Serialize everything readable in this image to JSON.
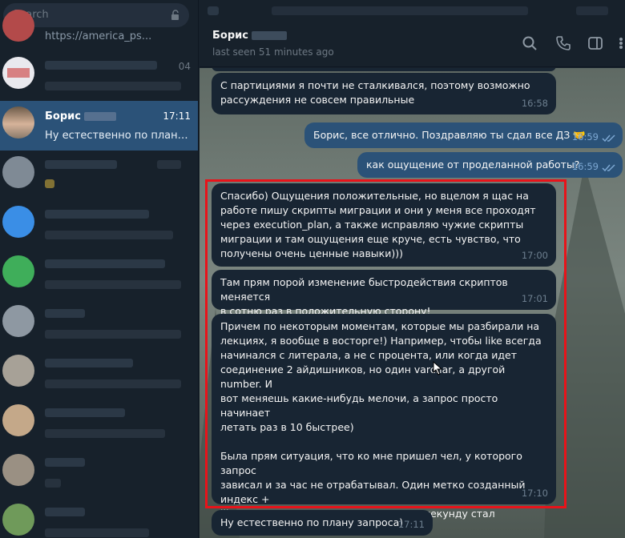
{
  "sidebar": {
    "search_placeholder": "Search",
    "chats": [
      {
        "preview": "https://america_ps..."
      },
      {
        "time": "04"
      },
      {
        "name": "Борис",
        "time": "17:11",
        "preview": "Ну естественно по плану запр..."
      }
    ]
  },
  "header": {
    "name": "Борис",
    "status": "last seen 51 minutes ago"
  },
  "messages": [
    {
      "direction": "in",
      "text": "С партициями я почти не сталкивался, поэтому возможно\nрассуждения не совсем правильные",
      "time": "16:58"
    },
    {
      "direction": "out",
      "text": "Борис, все отлично. Поздравляю ты сдал все ДЗ 🤝",
      "time": "16:59"
    },
    {
      "direction": "out",
      "text": "как ощущение от проделанной работы?",
      "time": "16:59"
    },
    {
      "direction": "in",
      "text": "Спасибо) Ощущения положительные, но вцелом я щас на\nработе пишу скрипты миграции и они у меня все проходят\nчерез execution_plan, а также исправляю чужие скрипты\nмиграции и там ощущения еще круче, есть чувство, что\nполучены очень ценные навыки)))",
      "time": "17:00"
    },
    {
      "direction": "in",
      "text": "Там прям порой изменение быстродействия скриптов меняется\nв сотню раз в положительную сторону!",
      "time": "17:01"
    },
    {
      "direction": "in",
      "text": "Причем по некоторым моментам, которые мы разбирали на\nлекциях, я вообще в восторге!) Например, чтобы like всегда\nначинался с литерала, а не с процента, или когда идет\nсоединение 2 айдишников, но один varchar, а другой number. И\nвот меняешь какие-нибудь мелочи, а запрос просто начинает\nлетать раз в 10 быстрее)\n\nБыла прям ситуация, что ко мне пришел чел, у которого запрос\nзависал и за час не отрабатывал. Один метко созданный индекс +\nlike поправил и он там меньше чем за секунду стал\nотрабатывать)",
      "time": "17:10",
      "reactions": [
        "👍",
        "🔥"
      ]
    },
    {
      "direction": "in",
      "text": "Ну естественно по плану запроса)",
      "time": "17:11"
    }
  ],
  "colors": {
    "sidebar_bg": "#17212b",
    "active_chat": "#2b5278",
    "incoming_bubble": "#182533",
    "outgoing_bubble": "#2b5278",
    "highlight_border": "#e8131a"
  },
  "icons": [
    "lock-icon",
    "search-icon",
    "phone-icon",
    "sidebar-toggle-icon",
    "more-icon",
    "double-check-icon",
    "cursor-icon"
  ]
}
